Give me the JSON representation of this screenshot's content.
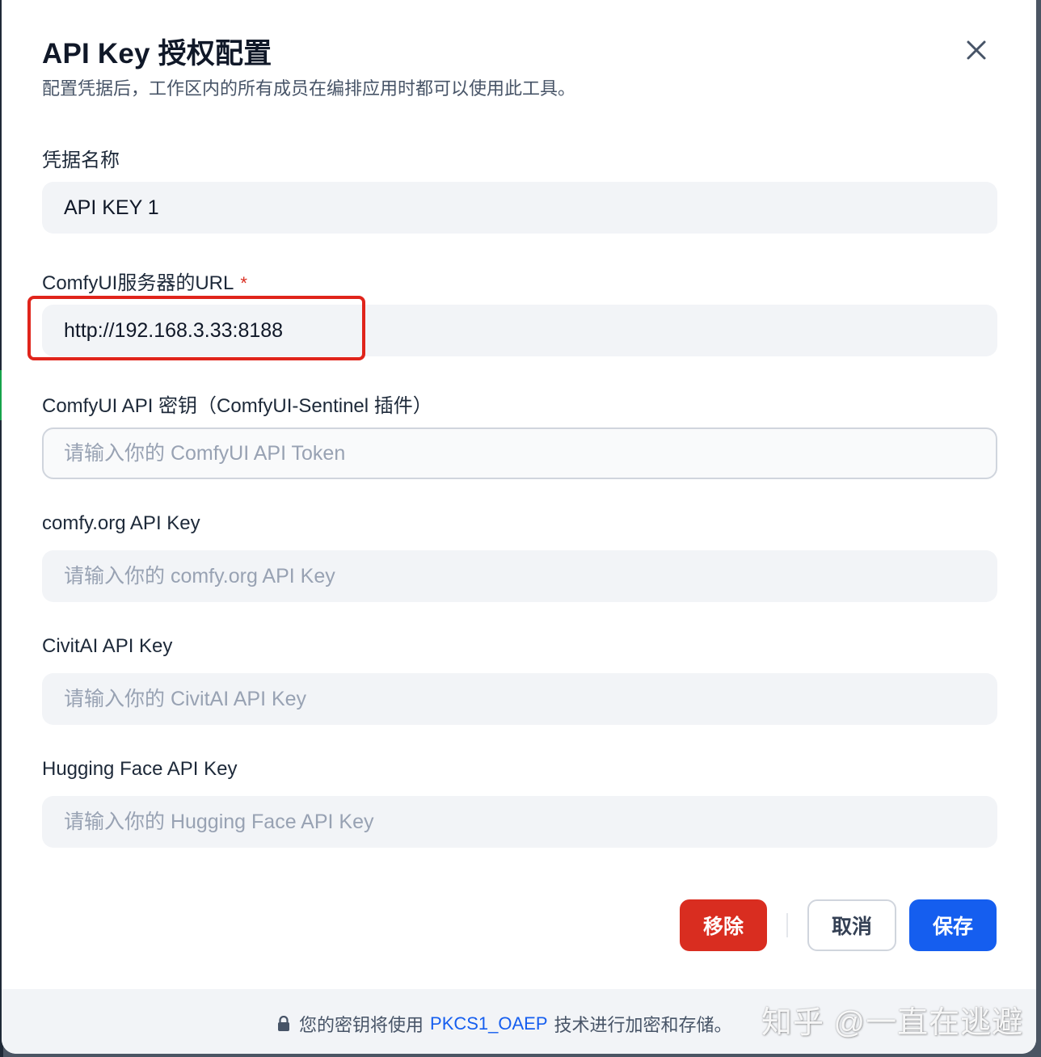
{
  "dialog": {
    "title": "API Key 授权配置",
    "subtitle": "配置凭据后，工作区内的所有成员在编排应用时都可以使用此工具。"
  },
  "fields": {
    "credential_name": {
      "label": "凭据名称",
      "value": "API KEY 1",
      "placeholder": ""
    },
    "comfyui_url": {
      "label": "ComfyUI服务器的URL",
      "required_mark": "*",
      "value": "http://192.168.3.33:8188",
      "placeholder": ""
    },
    "comfyui_api_key": {
      "label": "ComfyUI API 密钥（ComfyUI-Sentinel 插件）",
      "value": "",
      "placeholder": "请输入你的 ComfyUI API Token"
    },
    "comfy_org_key": {
      "label": "comfy.org API Key",
      "value": "",
      "placeholder": "请输入你的 comfy.org API Key"
    },
    "civitai_key": {
      "label": "CivitAI API Key",
      "value": "",
      "placeholder": "请输入你的 CivitAI API Key"
    },
    "huggingface_key": {
      "label": "Hugging Face API Key",
      "value": "",
      "placeholder": "请输入你的 Hugging Face API Key"
    }
  },
  "buttons": {
    "remove": "移除",
    "cancel": "取消",
    "save": "保存"
  },
  "footer": {
    "text_before": "您的密钥将使用",
    "link": "PKCS1_OAEP",
    "text_after": "技术进行加密和存储。"
  },
  "watermark": "知乎 @一直在逃避",
  "colors": {
    "primary": "#155eef",
    "danger": "#d92d20",
    "highlight": "#e0241b"
  }
}
